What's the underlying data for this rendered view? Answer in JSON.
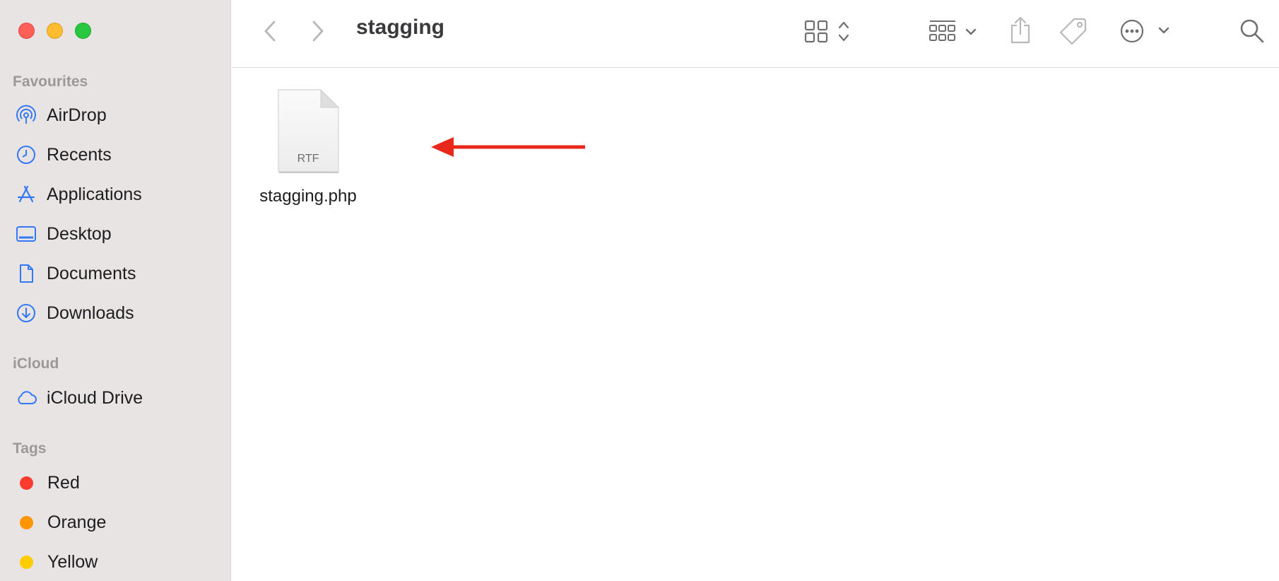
{
  "window": {
    "title": "stagging"
  },
  "sidebar": {
    "favourites_title": "Favourites",
    "favourites": [
      {
        "label": "AirDrop",
        "icon": "airdrop-icon"
      },
      {
        "label": "Recents",
        "icon": "clock-icon"
      },
      {
        "label": "Applications",
        "icon": "applications-icon"
      },
      {
        "label": "Desktop",
        "icon": "desktop-icon"
      },
      {
        "label": "Documents",
        "icon": "document-icon"
      },
      {
        "label": "Downloads",
        "icon": "download-icon"
      }
    ],
    "icloud_title": "iCloud",
    "icloud": [
      {
        "label": "iCloud Drive",
        "icon": "cloud-icon"
      }
    ],
    "tags_title": "Tags",
    "tags": [
      {
        "label": "Red",
        "color": "#fe3b30"
      },
      {
        "label": "Orange",
        "color": "#ff9500"
      },
      {
        "label": "Yellow",
        "color": "#ffcc00"
      }
    ]
  },
  "toolbar": {
    "icons": [
      "back-icon",
      "forward-icon",
      "icon-view-icon",
      "group-icon",
      "share-icon",
      "tag-icon",
      "more-icon",
      "search-icon"
    ]
  },
  "files": [
    {
      "name": "stagging.php",
      "kind_badge": "RTF"
    }
  ],
  "colors": {
    "accent": "#3478f6",
    "annotation_arrow": "#e8281b"
  }
}
